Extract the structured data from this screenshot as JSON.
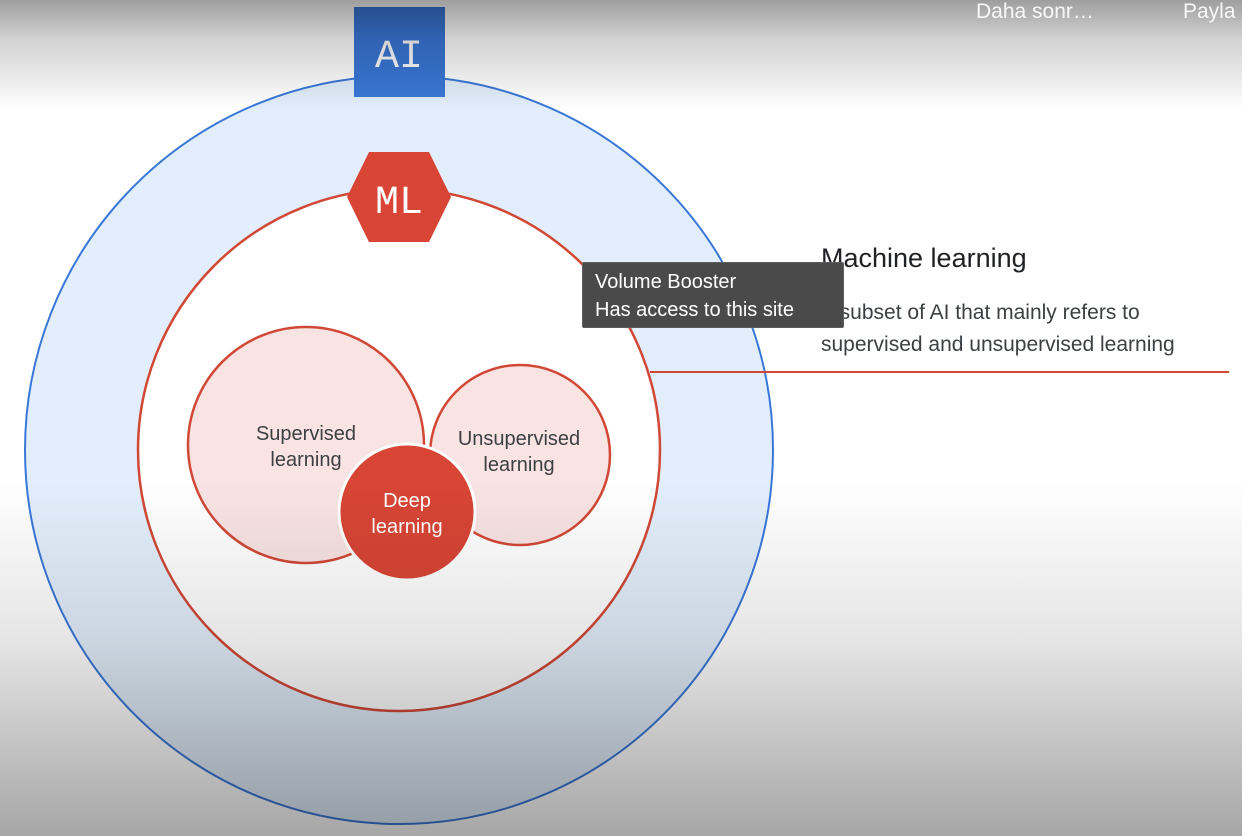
{
  "player_overlay": {
    "watch_later_label": "Daha sonr…",
    "share_label": "Payla"
  },
  "diagram": {
    "outer_label": "AI",
    "middle_label": "ML",
    "circles": [
      {
        "label": "Supervised\nlearning"
      },
      {
        "label": "Unsupervised\nlearning"
      },
      {
        "label": "Deep\nlearning"
      }
    ],
    "colors": {
      "ai_blue": "#3a78d8",
      "ai_fill": "#e2eefb",
      "ml_red": "#d14836",
      "inner_fill": "#f9e3e3",
      "deep_fill": "#d84535"
    }
  },
  "callout": {
    "title": "Machine learning",
    "description": "A subset of AI that mainly refers to supervised and unsupervised learning"
  },
  "tooltip": {
    "line1": "Volume Booster",
    "line2": "Has access to this site"
  }
}
